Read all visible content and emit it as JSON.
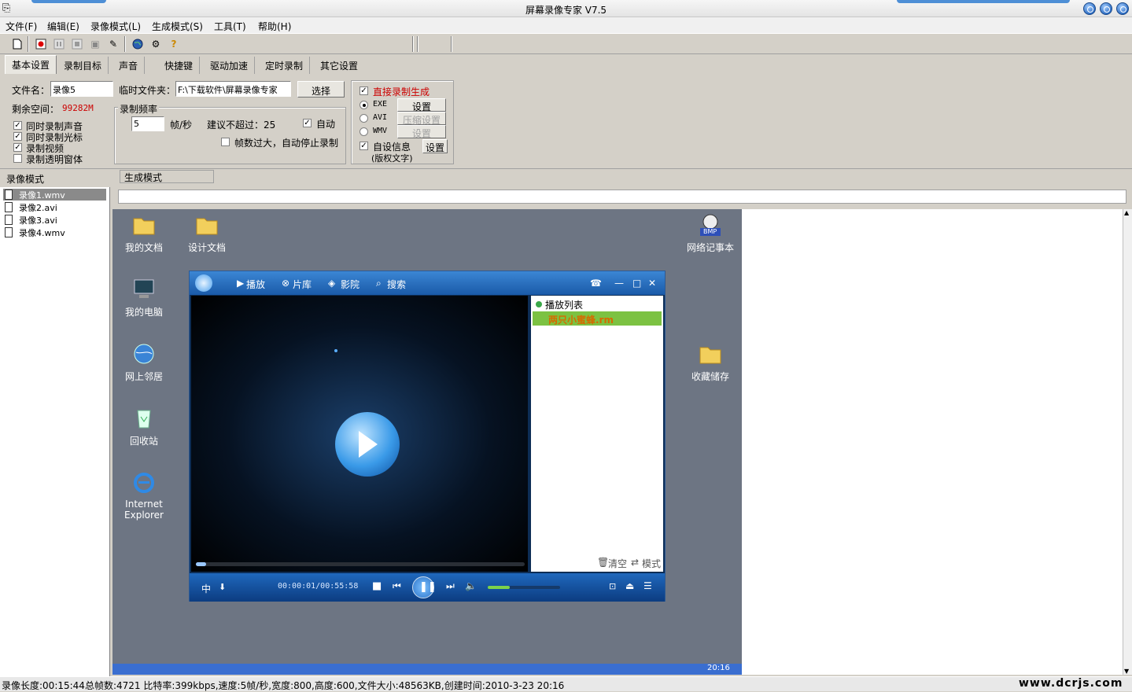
{
  "window": {
    "title": "屏幕录像专家 V7.5"
  },
  "menu": [
    "文件(F)",
    "编辑(E)",
    "录像模式(L)",
    "生成模式(S)",
    "工具(T)",
    "帮助(H)"
  ],
  "tabs": [
    "基本设置",
    "录制目标",
    "声音",
    "快捷键",
    "驱动加速",
    "定时录制",
    "其它设置"
  ],
  "settings": {
    "filename_label": "文件名：",
    "filename_value": "录像5",
    "tempfolder_label": "临时文件夹：",
    "tempfolder_value": "F:\\下载软件\\屏幕录像专家",
    "select_button": "选择",
    "free_space_label": "剩余空间：",
    "free_space_value": "99282M",
    "checks": [
      {
        "label": "同时录制声音",
        "checked": true
      },
      {
        "label": "同时录制光标",
        "checked": true
      },
      {
        "label": "录制视频",
        "checked": true
      },
      {
        "label": "录制透明窗体",
        "checked": false
      }
    ],
    "framerate_group": "录制频率",
    "fps_value": "5",
    "fps_unit": "帧/秒",
    "suggest_text": "建议不超过：25",
    "auto_label": "自动",
    "auto_stop_label": "帧数过大，自动停止录制",
    "direct_gen_label": "直接录制生成",
    "formats": [
      {
        "label": "EXE",
        "button": "设置",
        "disabled": false,
        "selected": true
      },
      {
        "label": "AVI",
        "button": "压缩设置",
        "disabled": true,
        "selected": false
      },
      {
        "label": "WMV",
        "button": "设置",
        "disabled": true,
        "selected": false
      }
    ],
    "custom_info_label": "自设信息",
    "custom_info_sub": "(版权文字)",
    "custom_info_button": "设置"
  },
  "section_labels": {
    "record_mode": "录像模式",
    "generate_mode": "生成模式"
  },
  "files": [
    "录像1.wmv",
    "录像2.avi",
    "录像3.avi",
    "录像4.wmv"
  ],
  "desktop": {
    "icons": [
      "我的文档",
      "设计文档",
      "我的电脑",
      "网上邻居",
      "回收站",
      "Internet Explorer",
      "网络记事本",
      "收藏储存"
    ],
    "bmp_badge": "BMP",
    "taskbar_time": "20:16"
  },
  "player": {
    "nav": [
      "播放",
      "片库",
      "影院",
      "搜索"
    ],
    "playlist_title": "播放列表",
    "playlist_item": "两只小蜜蜂.rm",
    "clear_label": "清空",
    "mode_label": "模式",
    "time": "00:00:01/00:55:58",
    "lang_label": "中",
    "progress": 0.03,
    "volume": 0.3
  },
  "status": {
    "text": "录像长度:00:15:44总帧数:4721 比特率:399kbps,速度:5帧/秒,宽度:800,高度:600,文件大小:48563KB,创建时间:2010-3-23 20:16",
    "watermark": "www.dcrjs.com"
  },
  "colors": {
    "accent_red": "#cc0000",
    "player_blue": "#1a5aa8",
    "playlist_green": "#7cc242",
    "playlist_item_text": "#d66a00"
  }
}
